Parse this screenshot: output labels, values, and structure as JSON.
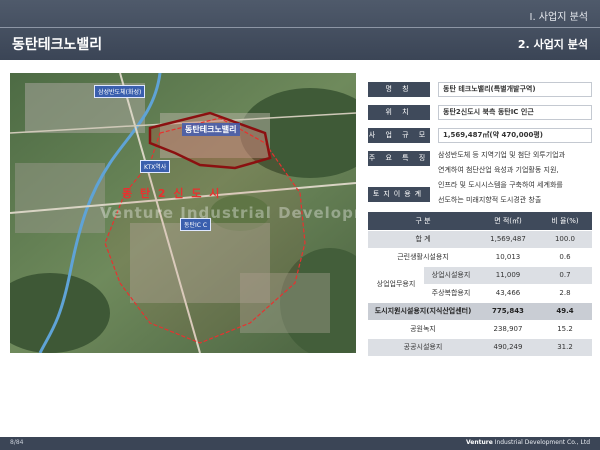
{
  "header": {
    "section": "Ⅰ. 사업지 분석",
    "title": "동탄테크노밸리",
    "subsection": "2. 사업지 분석"
  },
  "map": {
    "labels": {
      "hall": "삼성반도체(화성)",
      "ktx": "KTX역사",
      "ic": "동탄IC  C",
      "techno": "동탄테크노밸리",
      "newtown": "동 탄 2 신 도 시"
    },
    "watermark": "Venture Industrial Development Co., Ltd",
    "colors": {
      "boundary_red": "#e8312f",
      "boundary_dark": "#8b1010",
      "river": "#5fa3d6"
    }
  },
  "info": [
    {
      "label": "명 칭",
      "value": "동탄 테크노밸리(특별개발구역)"
    },
    {
      "label": "위 치",
      "value": "동탄2신도시 북측 동탄IC 인근"
    },
    {
      "label": "사 업 규 모",
      "value": "1,569,487㎡(약 470,000평)"
    },
    {
      "label": "주 요 특 징",
      "value": ""
    },
    {
      "label": "토지이용계획",
      "value": ""
    }
  ],
  "feature_lines": [
    "삼성반도체 등 지역기업 및 첨단 외투기업과",
    "연계하여 첨단산업 육성과 기업활동 지원,",
    "인프라 및 도시시스템을 구축하여 세계화를",
    "선도하는 미래지향적 도시경관 창출"
  ],
  "table": {
    "headers": [
      "구 분",
      "면 적(㎡)",
      "비 율(%)"
    ],
    "rows": {
      "total": [
        "합 계",
        "1,569,487",
        "100.0"
      ],
      "nbhd": [
        "근린생활시설용지",
        "10,013",
        "0.6"
      ],
      "biz_group": "상업업무용지",
      "biz1": [
        "상업시설용지",
        "11,009",
        "0.7"
      ],
      "biz2": [
        "주상복합용지",
        "43,466",
        "2.8"
      ],
      "knowledge": [
        "도시지원시설용지(지식산업센터)",
        "775,843",
        "49.4"
      ],
      "park": [
        "공원녹지",
        "238,907",
        "15.2"
      ],
      "public": [
        "공공시설용지",
        "490,249",
        "31.2"
      ]
    }
  },
  "footer": {
    "page": "8/84",
    "company_bold": "Venture",
    "company_rest": " Industrial Development Co., Ltd"
  }
}
